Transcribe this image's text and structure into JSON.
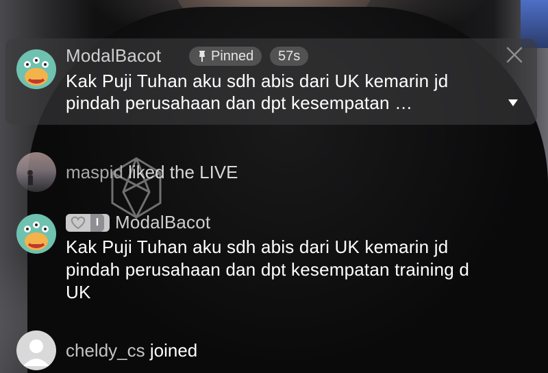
{
  "pinned": {
    "username": "ModalBacot",
    "pinned_label": "Pinned",
    "time": "57s",
    "text_line1": "Kak Puji Tuhan aku sdh abis dari UK kemarin jd",
    "text_line2": "pindah perusahaan dan dpt kesempatan …"
  },
  "like_event": {
    "username": "maspid",
    "text": "liked the LIVE"
  },
  "comment": {
    "badge_level": "I",
    "username": "ModalBacot",
    "text_line1": "Kak Puji Tuhan aku sdh abis dari UK kemarin jd",
    "text_line2": "pindah perusahaan dan dpt kesempatan training d",
    "text_line3": "UK"
  },
  "join_event": {
    "username": "cheldy_cs",
    "text": "joined"
  },
  "icons": [
    "pin-icon",
    "close-icon",
    "chevron-down-icon",
    "heart-icon",
    "monster-avatar-icon",
    "default-avatar-icon"
  ],
  "colors": {
    "avatar_teal": "#6fc1b0",
    "card_bg": "rgba(60,60,62,0.62)"
  }
}
